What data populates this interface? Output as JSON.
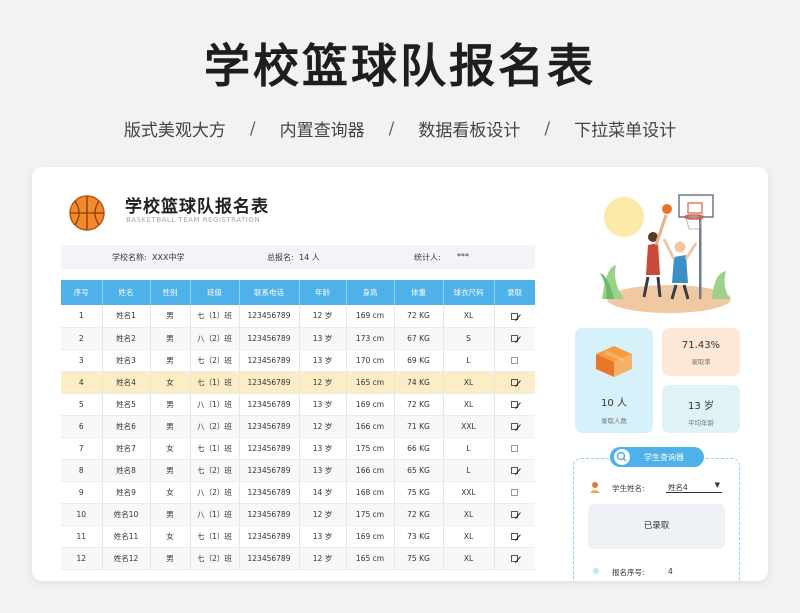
{
  "hero": {
    "title": "学校篮球队报名表",
    "tagline": [
      "版式美观大方",
      "内置查询器",
      "数据看板设计",
      "下拉菜单设计"
    ],
    "separator": "/"
  },
  "form": {
    "title": "学校篮球队报名表",
    "subtitle": "BASKETBALL TEAM REGISTRATION",
    "school_label": "学校名称:",
    "school_value": "XXX中学",
    "total_label": "总报名:",
    "total_value": "14 人",
    "stat_label": "统计人:",
    "stat_value": "***"
  },
  "table": {
    "headers": [
      "序号",
      "姓名",
      "性别",
      "班级",
      "联系电话",
      "年龄",
      "身高",
      "体重",
      "球衣尺码",
      "录取"
    ],
    "rows": [
      {
        "no": "1",
        "name": "姓名1",
        "gender": "男",
        "class": "七（1）班",
        "phone": "123456789",
        "age": "12 岁",
        "height": "169 cm",
        "weight": "72 KG",
        "size": "XL",
        "admitted": true
      },
      {
        "no": "2",
        "name": "姓名2",
        "gender": "男",
        "class": "八（2）班",
        "phone": "123456789",
        "age": "13 岁",
        "height": "173 cm",
        "weight": "67 KG",
        "size": "S",
        "admitted": true
      },
      {
        "no": "3",
        "name": "姓名3",
        "gender": "男",
        "class": "七（2）班",
        "phone": "123456789",
        "age": "13 岁",
        "height": "170 cm",
        "weight": "69 KG",
        "size": "L",
        "admitted": false
      },
      {
        "no": "4",
        "name": "姓名4",
        "gender": "女",
        "class": "七（1）班",
        "phone": "123456789",
        "age": "12 岁",
        "height": "165 cm",
        "weight": "74 KG",
        "size": "XL",
        "admitted": true
      },
      {
        "no": "5",
        "name": "姓名5",
        "gender": "男",
        "class": "八（1）班",
        "phone": "123456789",
        "age": "13 岁",
        "height": "169 cm",
        "weight": "72 KG",
        "size": "XL",
        "admitted": true
      },
      {
        "no": "6",
        "name": "姓名6",
        "gender": "男",
        "class": "八（2）班",
        "phone": "123456789",
        "age": "12 岁",
        "height": "166 cm",
        "weight": "71 KG",
        "size": "XXL",
        "admitted": true
      },
      {
        "no": "7",
        "name": "姓名7",
        "gender": "女",
        "class": "七（1）班",
        "phone": "123456789",
        "age": "13 岁",
        "height": "175 cm",
        "weight": "66 KG",
        "size": "L",
        "admitted": false
      },
      {
        "no": "8",
        "name": "姓名8",
        "gender": "男",
        "class": "七（2）班",
        "phone": "123456789",
        "age": "13 岁",
        "height": "166 cm",
        "weight": "65 KG",
        "size": "L",
        "admitted": true
      },
      {
        "no": "9",
        "name": "姓名9",
        "gender": "女",
        "class": "八（2）班",
        "phone": "123456789",
        "age": "14 岁",
        "height": "168 cm",
        "weight": "75 KG",
        "size": "XXL",
        "admitted": false
      },
      {
        "no": "10",
        "name": "姓名10",
        "gender": "男",
        "class": "八（1）班",
        "phone": "123456789",
        "age": "12 岁",
        "height": "175 cm",
        "weight": "72 KG",
        "size": "XL",
        "admitted": true
      },
      {
        "no": "11",
        "name": "姓名11",
        "gender": "女",
        "class": "七（1）班",
        "phone": "123456789",
        "age": "13 岁",
        "height": "169 cm",
        "weight": "73 KG",
        "size": "XL",
        "admitted": true
      },
      {
        "no": "12",
        "name": "姓名12",
        "gender": "男",
        "class": "七（2）班",
        "phone": "123456789",
        "age": "12 岁",
        "height": "165 cm",
        "weight": "75 KG",
        "size": "XL",
        "admitted": true
      }
    ],
    "highlighted_row": 4
  },
  "stats": {
    "enrolled_value": "10 人",
    "enrolled_label": "录取人数",
    "rate_value": "71.43%",
    "rate_label": "录取率",
    "avg_age_value": "13 岁",
    "avg_age_label": "平均年龄"
  },
  "query": {
    "title": "学生查询器",
    "name_label": "学生姓名:",
    "name_value": "姓名4",
    "result": "已录取",
    "reg_no_label": "报名序号:",
    "reg_no_value": "4"
  },
  "colors": {
    "header_blue": "#4eb1ea",
    "highlight_row": "#fdedc6",
    "stat_blue": "#d7f1fb",
    "stat_peach": "#fde7d6",
    "stat_mint": "#dff3f4"
  }
}
